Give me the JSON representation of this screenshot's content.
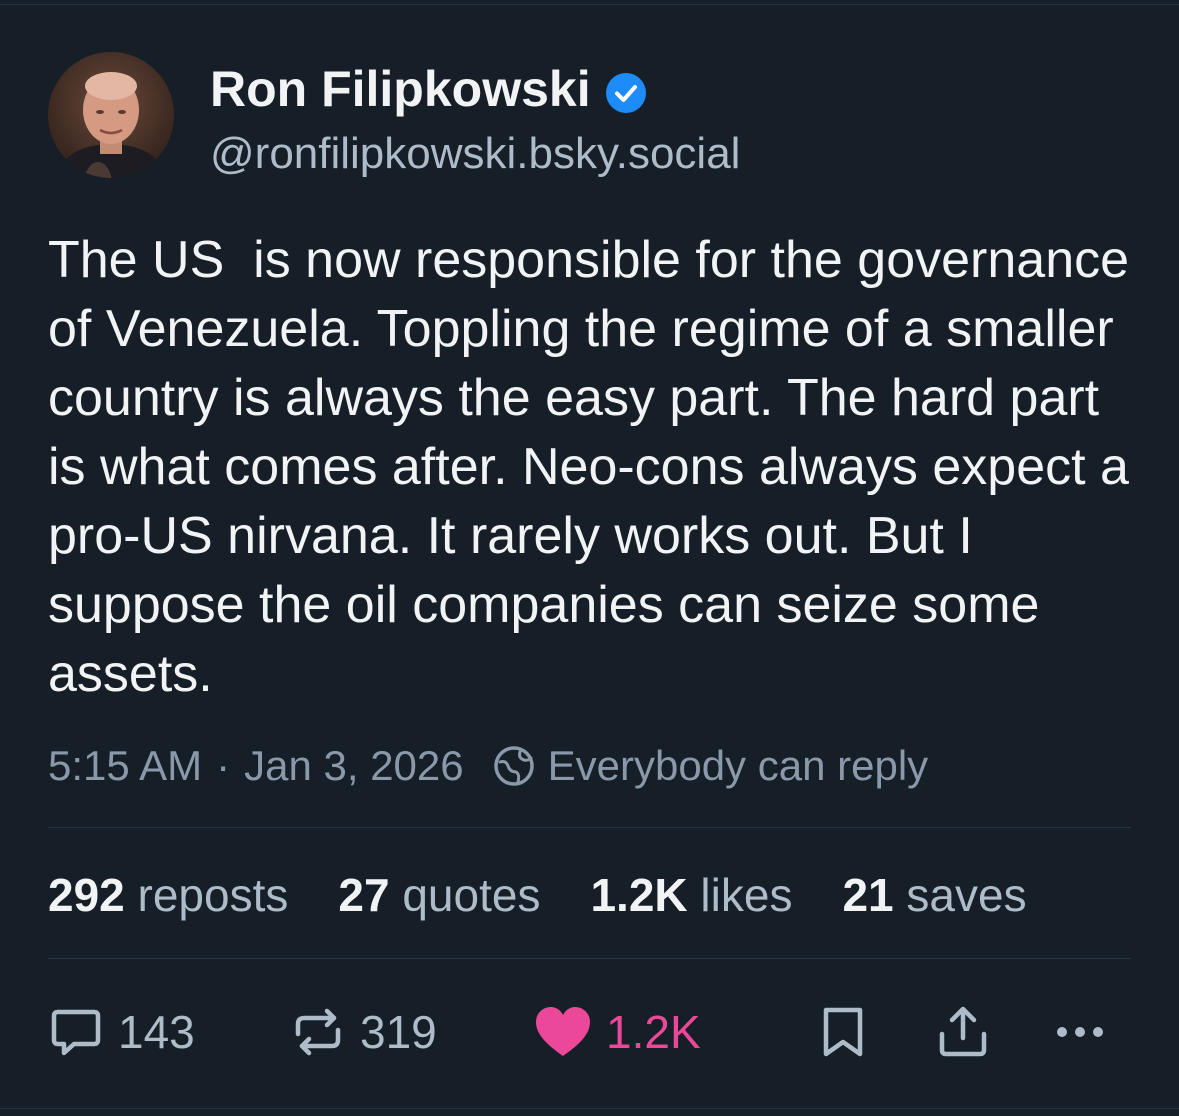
{
  "author": {
    "name": "Ron Filipkowski",
    "handle": "@ronfilipkowski.bsky.social",
    "verified": true
  },
  "post": {
    "text": "The US  is now responsible for the governance of Venezuela. Toppling the regime of a smaller country is always the easy part. The hard part is what comes after. Neo-cons always expect a pro-US nirvana. It rarely works out. But I suppose the oil companies can seize some assets.",
    "time": "5:15 AM",
    "separator": "·",
    "date": "Jan 3, 2026",
    "reply_setting": "Everybody can reply"
  },
  "stats": {
    "reposts_count": "292",
    "reposts_label": "reposts",
    "quotes_count": "27",
    "quotes_label": "quotes",
    "likes_count": "1.2K",
    "likes_label": "likes",
    "saves_count": "21",
    "saves_label": "saves"
  },
  "actions": {
    "reply_count": "143",
    "repost_count": "319",
    "like_count": "1.2K"
  },
  "icons": {
    "verified": "verified-check-icon",
    "globe": "globe-icon",
    "reply": "speech-bubble-icon",
    "repost": "repost-arrows-icon",
    "like": "heart-icon",
    "bookmark": "bookmark-icon",
    "share": "share-icon",
    "more": "ellipsis-icon"
  },
  "colors": {
    "background": "#161e27",
    "verified_blue": "#1d8cf8",
    "like_pink": "#ec4899",
    "muted_text": "#aebbc9"
  }
}
